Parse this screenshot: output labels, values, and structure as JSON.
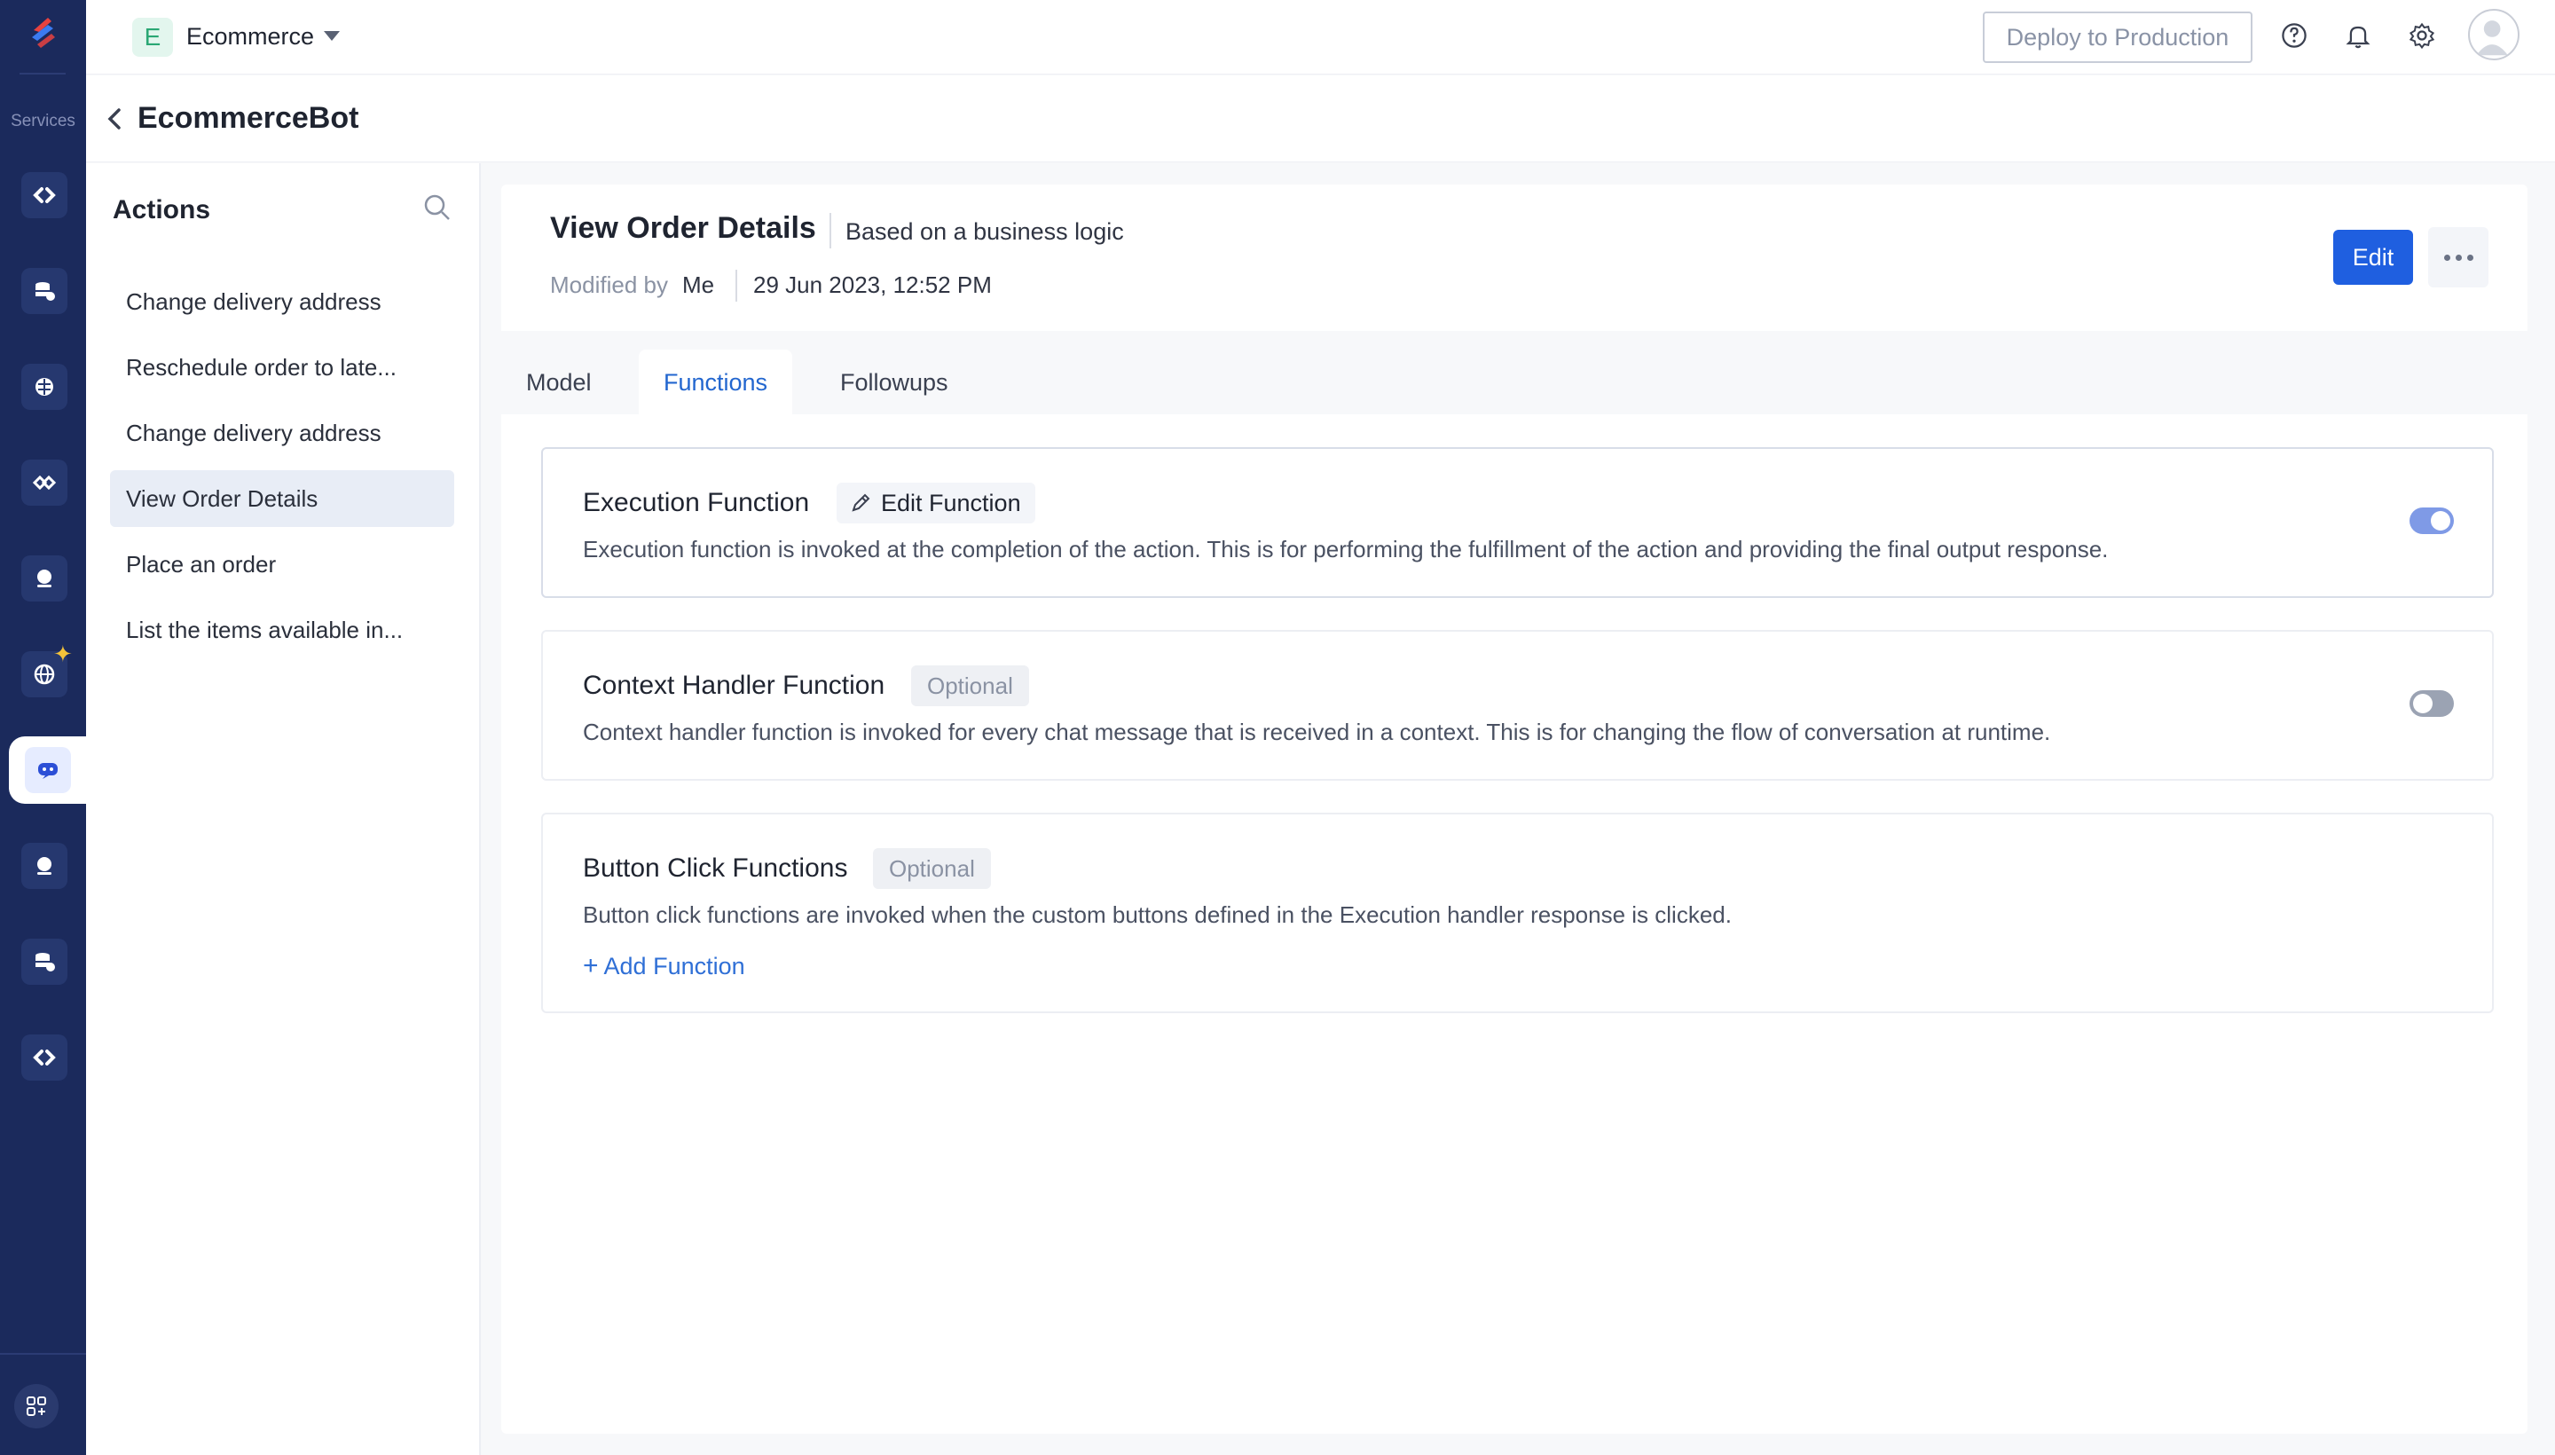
{
  "rail": {
    "services_label": "Services"
  },
  "topbar": {
    "project_initial": "E",
    "project_name": "Ecommerce",
    "deploy_label": "Deploy to Production"
  },
  "bot": {
    "title": "EcommerceBot"
  },
  "actions": {
    "title": "Actions",
    "items": [
      {
        "label": "Change delivery address"
      },
      {
        "label": "Reschedule order to late..."
      },
      {
        "label": "Change delivery address"
      },
      {
        "label": "View Order Details"
      },
      {
        "label": "Place an order"
      },
      {
        "label": "List the items available in..."
      }
    ],
    "active_index": 3
  },
  "detail": {
    "title": "View Order Details",
    "subtitle": "Based on a business logic",
    "modified_label": "Modified by",
    "modified_by": "Me",
    "modified_date": "29 Jun 2023, 12:52 PM",
    "edit_label": "Edit"
  },
  "tabs": [
    {
      "label": "Model"
    },
    {
      "label": "Functions"
    },
    {
      "label": "Followups"
    }
  ],
  "active_tab": 1,
  "functions": {
    "execution": {
      "title": "Execution Function",
      "edit_label": "Edit Function",
      "description": "Execution function is invoked at the completion of the action. This is for performing the fulfillment of the action and providing the final output response.",
      "enabled": true
    },
    "context_handler": {
      "title": "Context Handler Function",
      "optional_label": "Optional",
      "description": "Context handler function is invoked for every chat message that is received in a context. This is for changing the flow of conversation at runtime.",
      "enabled": false
    },
    "button_click": {
      "title": "Button Click Functions",
      "optional_label": "Optional",
      "description": "Button click functions are invoked when the custom buttons defined in the Execution handler response is clicked.",
      "add_label": "Add Function"
    }
  },
  "colors": {
    "rail_bg": "#1b2a5c",
    "accent": "#1f5fe0",
    "tab_active": "#2266cf",
    "toggle_on": "#7f9ae6"
  }
}
